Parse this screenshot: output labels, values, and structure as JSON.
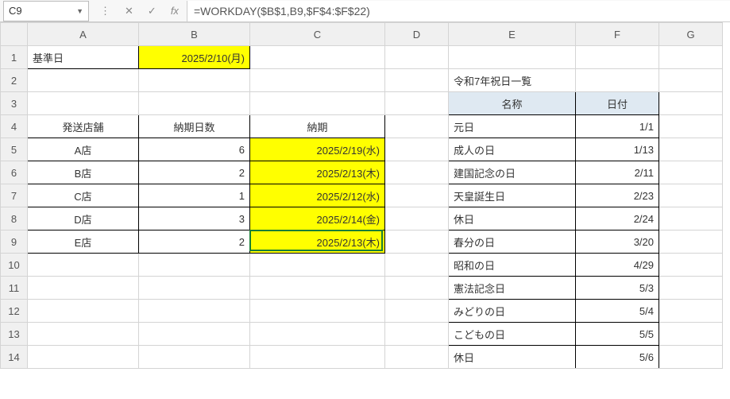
{
  "formula_bar": {
    "cell_ref": "C9",
    "formula": "=WORKDAY($B$1,B9,$F$4:$F$22)",
    "cancel": "✕",
    "accept": "✓",
    "fx": "fx",
    "expand": "⋮"
  },
  "columns": [
    "A",
    "B",
    "C",
    "D",
    "E",
    "F",
    "G"
  ],
  "rows": [
    "1",
    "2",
    "3",
    "4",
    "5",
    "6",
    "7",
    "8",
    "9",
    "10",
    "11",
    "12",
    "13",
    "14"
  ],
  "cells": {
    "A1": "基準日",
    "B1": "2025/2/10(月)",
    "E2": "令和7年祝日一覧",
    "E3": "名称",
    "F3": "日付",
    "A4": "発送店舗",
    "B4": "納期日数",
    "C4": "納期",
    "A5": "A店",
    "B5": "6",
    "C5": "2025/2/19(水)",
    "A6": "B店",
    "B6": "2",
    "C6": "2025/2/13(木)",
    "A7": "C店",
    "B7": "1",
    "C7": "2025/2/12(水)",
    "A8": "D店",
    "B8": "3",
    "C8": "2025/2/14(金)",
    "A9": "E店",
    "B9": "2",
    "C9": "2025/2/13(木)",
    "E4": "元日",
    "F4": "1/1",
    "E5": "成人の日",
    "F5": "1/13",
    "E6": "建国記念の日",
    "F6": "2/11",
    "E7": "天皇誕生日",
    "F7": "2/23",
    "E8": "休日",
    "F8": "2/24",
    "E9": "春分の日",
    "F9": "3/20",
    "E10": "昭和の日",
    "F10": "4/29",
    "E11": "憲法記念日",
    "F11": "5/3",
    "E12": "みどりの日",
    "F12": "5/4",
    "E13": "こどもの日",
    "F13": "5/5",
    "E14": "休日",
    "F14": "5/6"
  },
  "chart_data": {
    "type": "table",
    "tables": [
      {
        "title": "納期計算",
        "reference_date": "2025/2/10(月)",
        "columns": [
          "発送店舗",
          "納期日数",
          "納期"
        ],
        "rows": [
          [
            "A店",
            6,
            "2025/2/19(水)"
          ],
          [
            "B店",
            2,
            "2025/2/13(木)"
          ],
          [
            "C店",
            1,
            "2025/2/12(水)"
          ],
          [
            "D店",
            3,
            "2025/2/14(金)"
          ],
          [
            "E店",
            2,
            "2025/2/13(木)"
          ]
        ]
      },
      {
        "title": "令和7年祝日一覧",
        "columns": [
          "名称",
          "日付"
        ],
        "rows": [
          [
            "元日",
            "1/1"
          ],
          [
            "成人の日",
            "1/13"
          ],
          [
            "建国記念の日",
            "2/11"
          ],
          [
            "天皇誕生日",
            "2/23"
          ],
          [
            "休日",
            "2/24"
          ],
          [
            "春分の日",
            "3/20"
          ],
          [
            "昭和の日",
            "4/29"
          ],
          [
            "憲法記念日",
            "5/3"
          ],
          [
            "みどりの日",
            "5/4"
          ],
          [
            "こどもの日",
            "5/5"
          ],
          [
            "休日",
            "5/6"
          ]
        ]
      }
    ]
  }
}
